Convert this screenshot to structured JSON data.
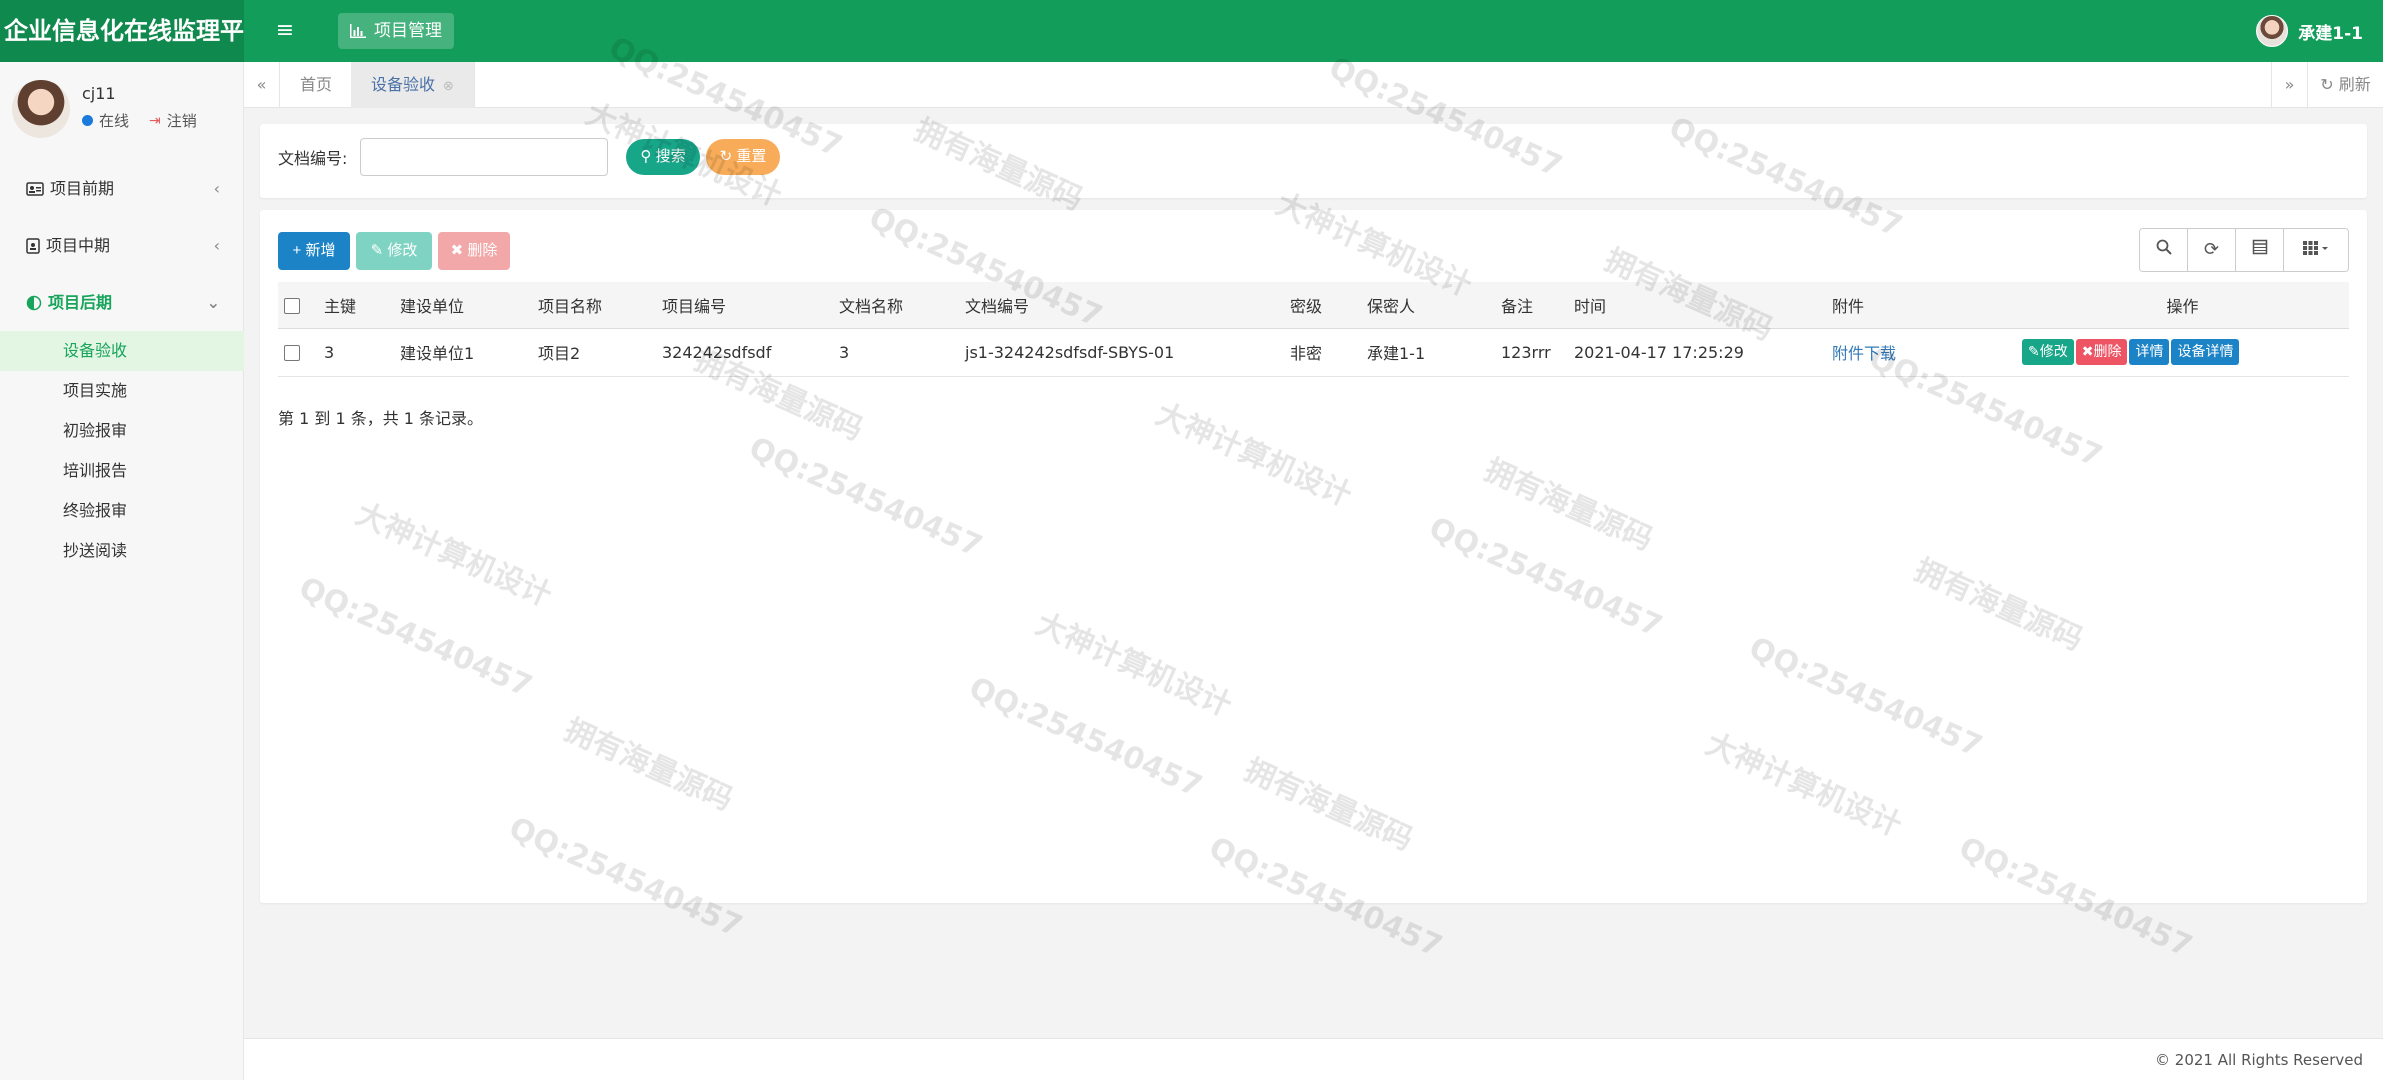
{
  "header": {
    "brand": "企业信息化在线监理平台",
    "menu_toggle": "≡",
    "nav_label": "项目管理",
    "user_name": "承建1-1"
  },
  "sidebar": {
    "profile_name": "cj11",
    "status_online": "在线",
    "status_logout": "注销",
    "groups": [
      {
        "label": "项目前期",
        "icon": "id-card-icon",
        "arrow": "‹"
      },
      {
        "label": "项目中期",
        "icon": "badge-icon",
        "arrow": "‹"
      },
      {
        "label": "项目后期",
        "icon": "half-circle-icon",
        "arrow": "⌄"
      }
    ],
    "sub_items": [
      {
        "label": "设备验收"
      },
      {
        "label": "项目实施"
      },
      {
        "label": "初验报审"
      },
      {
        "label": "培训报告"
      },
      {
        "label": "终验报审"
      },
      {
        "label": "抄送阅读"
      }
    ]
  },
  "tabs": {
    "home": "首页",
    "current": "设备验收",
    "refresh": "刷新"
  },
  "search": {
    "label": "文档编号:",
    "value": "",
    "search_button": "搜索",
    "reset_button": "重置"
  },
  "toolbar": {
    "add": "新增",
    "edit": "修改",
    "delete": "删除"
  },
  "table": {
    "columns": [
      "主键",
      "建设单位",
      "项目名称",
      "项目编号",
      "文档名称",
      "文档编号",
      "密级",
      "保密人",
      "备注",
      "时间",
      "附件",
      "操作"
    ],
    "rows": [
      {
        "id": "3",
        "unit": "建设单位1",
        "project_name": "项目2",
        "project_no": "324242sdfsdf",
        "doc_name": "3",
        "doc_no": "js1-324242sdfsdf-SBYS-01",
        "secret_level": "非密",
        "keeper": "承建1-1",
        "remark": "123rrr",
        "time": "2021-04-17 17:25:29",
        "attachment": "附件下载",
        "ops": {
          "edit": "修改",
          "delete": "删除",
          "detail": "详情",
          "device_detail": "设备详情"
        }
      }
    ],
    "pagination": "第 1 到 1 条，共 1 条记录。"
  },
  "footer": {
    "text": "© 2021 All Rights Reserved"
  },
  "watermarks": [
    "QQ:254540457",
    "大神计算机设计",
    "拥有海量源码"
  ],
  "colors": {
    "header_green": "#139d5a",
    "brand_green": "#10894e",
    "search_btn": "#18a689",
    "reset_btn": "#f8ac59",
    "add_btn": "#1c84c6",
    "delete_btn": "#ed5565"
  }
}
